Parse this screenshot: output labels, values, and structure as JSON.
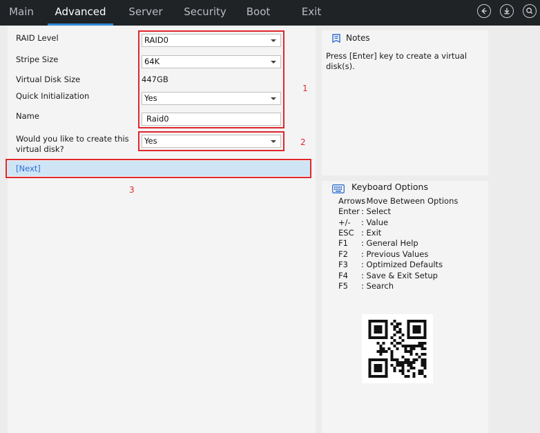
{
  "tabs": [
    {
      "label": "Main"
    },
    {
      "label": "Advanced"
    },
    {
      "label": "Server"
    },
    {
      "label": "Security"
    },
    {
      "label": "Boot"
    },
    {
      "label": "Exit"
    }
  ],
  "icons": [
    "back-icon",
    "download-icon",
    "search-icon"
  ],
  "form": {
    "raid_level": {
      "label": "RAID Level",
      "value": "RAID0"
    },
    "stripe_size": {
      "label": "Stripe Size",
      "value": "64K"
    },
    "virtual_disk_size": {
      "label": "Virtual Disk Size",
      "value": "447GB"
    },
    "quick_init": {
      "label": "Quick Initialization",
      "value": "Yes"
    },
    "name": {
      "label": "Name",
      "value": "Raid0"
    },
    "create_confirm": {
      "label_line1": "Would you like to create this",
      "label_line2": "virtual disk?",
      "value": "Yes"
    },
    "next": "[Next]"
  },
  "annotations": [
    "1",
    "2",
    "3"
  ],
  "notes": {
    "title": "Notes",
    "text": "Press [Enter] key to create a virtual disk(s)."
  },
  "keyboard": {
    "title": "Keyboard Options",
    "items": [
      {
        "key": "Arrows",
        "desc": ": Move Between Options"
      },
      {
        "key": "Enter",
        "desc": ": Select"
      },
      {
        "key": "+/-",
        "desc": ": Value"
      },
      {
        "key": "ESC",
        "desc": ": Exit"
      },
      {
        "key": "F1",
        "desc": ": General Help"
      },
      {
        "key": "F2",
        "desc": ": Previous Values"
      },
      {
        "key": "F3",
        "desc": ": Optimized Defaults"
      },
      {
        "key": "F4",
        "desc": ": Save & Exit Setup"
      },
      {
        "key": "F5",
        "desc": ": Search"
      }
    ]
  },
  "colors": {
    "topbar": "#1f2326",
    "accent": "#2e89d6",
    "annotation": "#e0262c",
    "link": "#2b6fd6",
    "selected_row": "#cfe4f5"
  }
}
